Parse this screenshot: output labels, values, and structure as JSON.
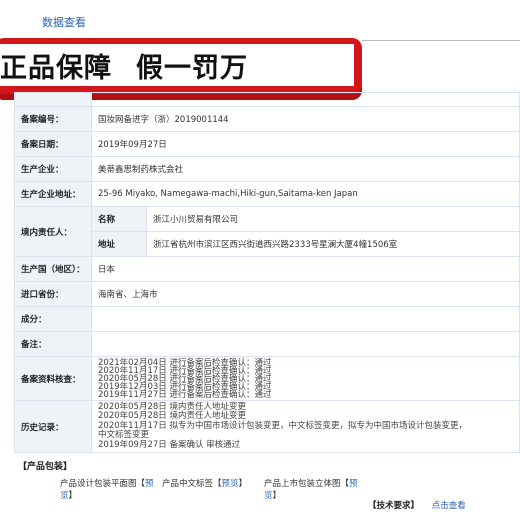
{
  "header": {
    "link": "数据查看"
  },
  "banner": {
    "part1": "正品保障",
    "part2": "假一罚万"
  },
  "rows": {
    "record_no": {
      "label": "备案编号：",
      "value": "国妆网备进字（浙）2019001144"
    },
    "record_date": {
      "label": "备案日期：",
      "value": "2019年09月27日"
    },
    "manufacturer": {
      "label": "生产企业：",
      "value": "美蒂鑫思制药株式会社"
    },
    "manufacturer_addr": {
      "label": "生产企业地址：",
      "value": "25-96 Miyako, Namegawa-machi,Hiki-gun,Saitama-ken Japan"
    },
    "domestic": {
      "label": "境内责任人：",
      "name_label": "名称",
      "name_value": "浙江小川贸易有限公司",
      "addr_label": "地址",
      "addr_value": "浙江省杭州市滨江区西兴街道西兴路2333号星澜大厦4幢1506室"
    },
    "country": {
      "label": "生产国（地区）：",
      "value": "日本"
    },
    "port": {
      "label": "进口省份：",
      "value": "海南省、上海市"
    },
    "ingredients": {
      "label": "成分：",
      "value": ""
    },
    "remark": {
      "label": "备注：",
      "value": ""
    },
    "review": {
      "label": "备案资料核查：",
      "lines": [
        "2021年02月04日  进行备案后检查确认：通过",
        "2020年11月17日  进行备案后检查确认：通过",
        "2020年05月28日  进行备案后检查确认：通过",
        "2019年12月03日  进行备案后检查确认：通过",
        "2019年11月27日  进行备案后检查确认：通过"
      ]
    },
    "history": {
      "label": "历史记录：",
      "lines": [
        "2020年05月28日  境内责任人地址变更",
        "2020年05月28日  境内责任人地址变更",
        "2020年11月17日  拟专为中国市场设计包装变更，中文标签变更，拟专为中国市场设计包装变更，",
        "中文标签变更",
        "2019年09月27日  备案确认 审核通过"
      ]
    }
  },
  "packaging": {
    "title": "【产品包装】",
    "items": [
      {
        "label": "产品设计包装平面图",
        "bracket_open": "【",
        "link1": "预",
        "link2": "览",
        "bracket_close": "】"
      },
      {
        "label": "产品中文标签",
        "bracket_open": "【",
        "link1": "预览",
        "bracket_close": "】"
      },
      {
        "label": "产品上市包装立体图",
        "bracket_open": "【",
        "link1": "预",
        "link2": "览",
        "bracket_close": "】"
      }
    ]
  },
  "tech": {
    "label": "【技术要求】",
    "link": "点击查看"
  }
}
